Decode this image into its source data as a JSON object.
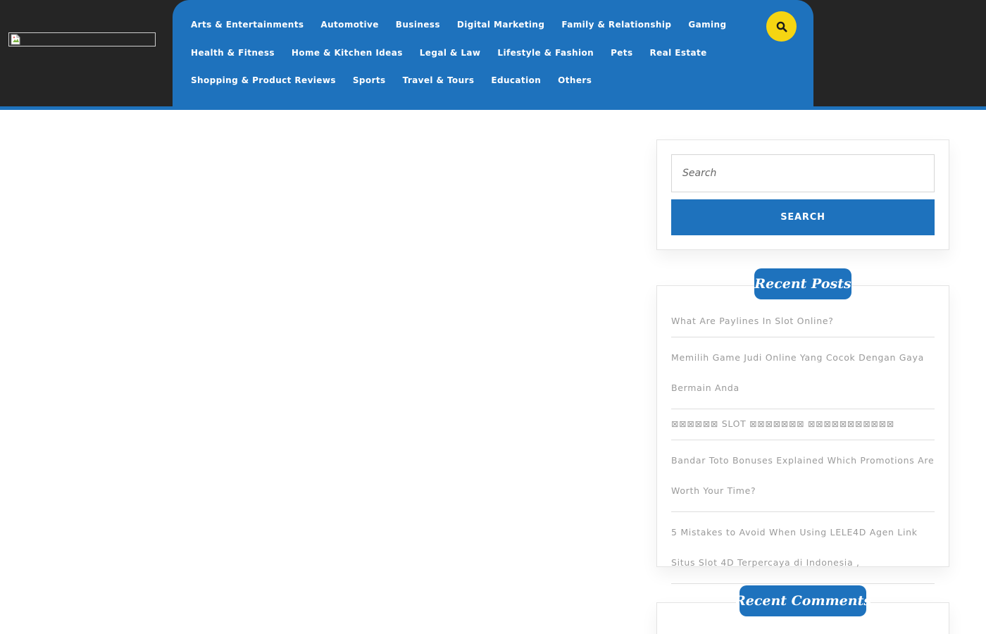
{
  "header": {
    "logo_alt": "",
    "nav_rows": [
      [
        "Arts & Entertainments",
        "Automotive",
        "Business",
        "Digital Marketing",
        "Family & Relationship",
        "Gaming"
      ],
      [
        "Health & Fitness",
        "Home & Kitchen Ideas",
        "Legal & Law",
        "Lifestyle & Fashion",
        "Pets",
        "Real Estate"
      ],
      [
        "Shopping & Product Reviews",
        "Sports",
        "Travel & Tours",
        "Education",
        "Others"
      ]
    ],
    "search_icon": "search-icon"
  },
  "sidebar": {
    "search": {
      "placeholder": "Search",
      "button_label": "SEARCH"
    },
    "recent_posts": {
      "title": "Recent Posts",
      "items": [
        "What Are Paylines In Slot Online?",
        "Memilih Game Judi Online Yang Cocok Dengan Gaya Bermain Anda",
        "⊠⊠⊠⊠⊠⊠ SLOT ⊠⊠⊠⊠⊠⊠⊠ ⊠⊠⊠⊠⊠⊠⊠⊠⊠⊠⊠",
        "Bandar Toto Bonuses Explained Which Promotions Are Worth Your Time?",
        "5 Mistakes to Avoid When Using LELE4D Agen Link Situs Slot 4D Terpercaya di Indonesia ,"
      ]
    },
    "recent_comments": {
      "title": "Recent Comments"
    }
  },
  "colors": {
    "header_bg": "#252525",
    "accent_blue": "#1e72bd",
    "search_yellow": "#f5d512",
    "post_text": "#9a9a9a"
  }
}
